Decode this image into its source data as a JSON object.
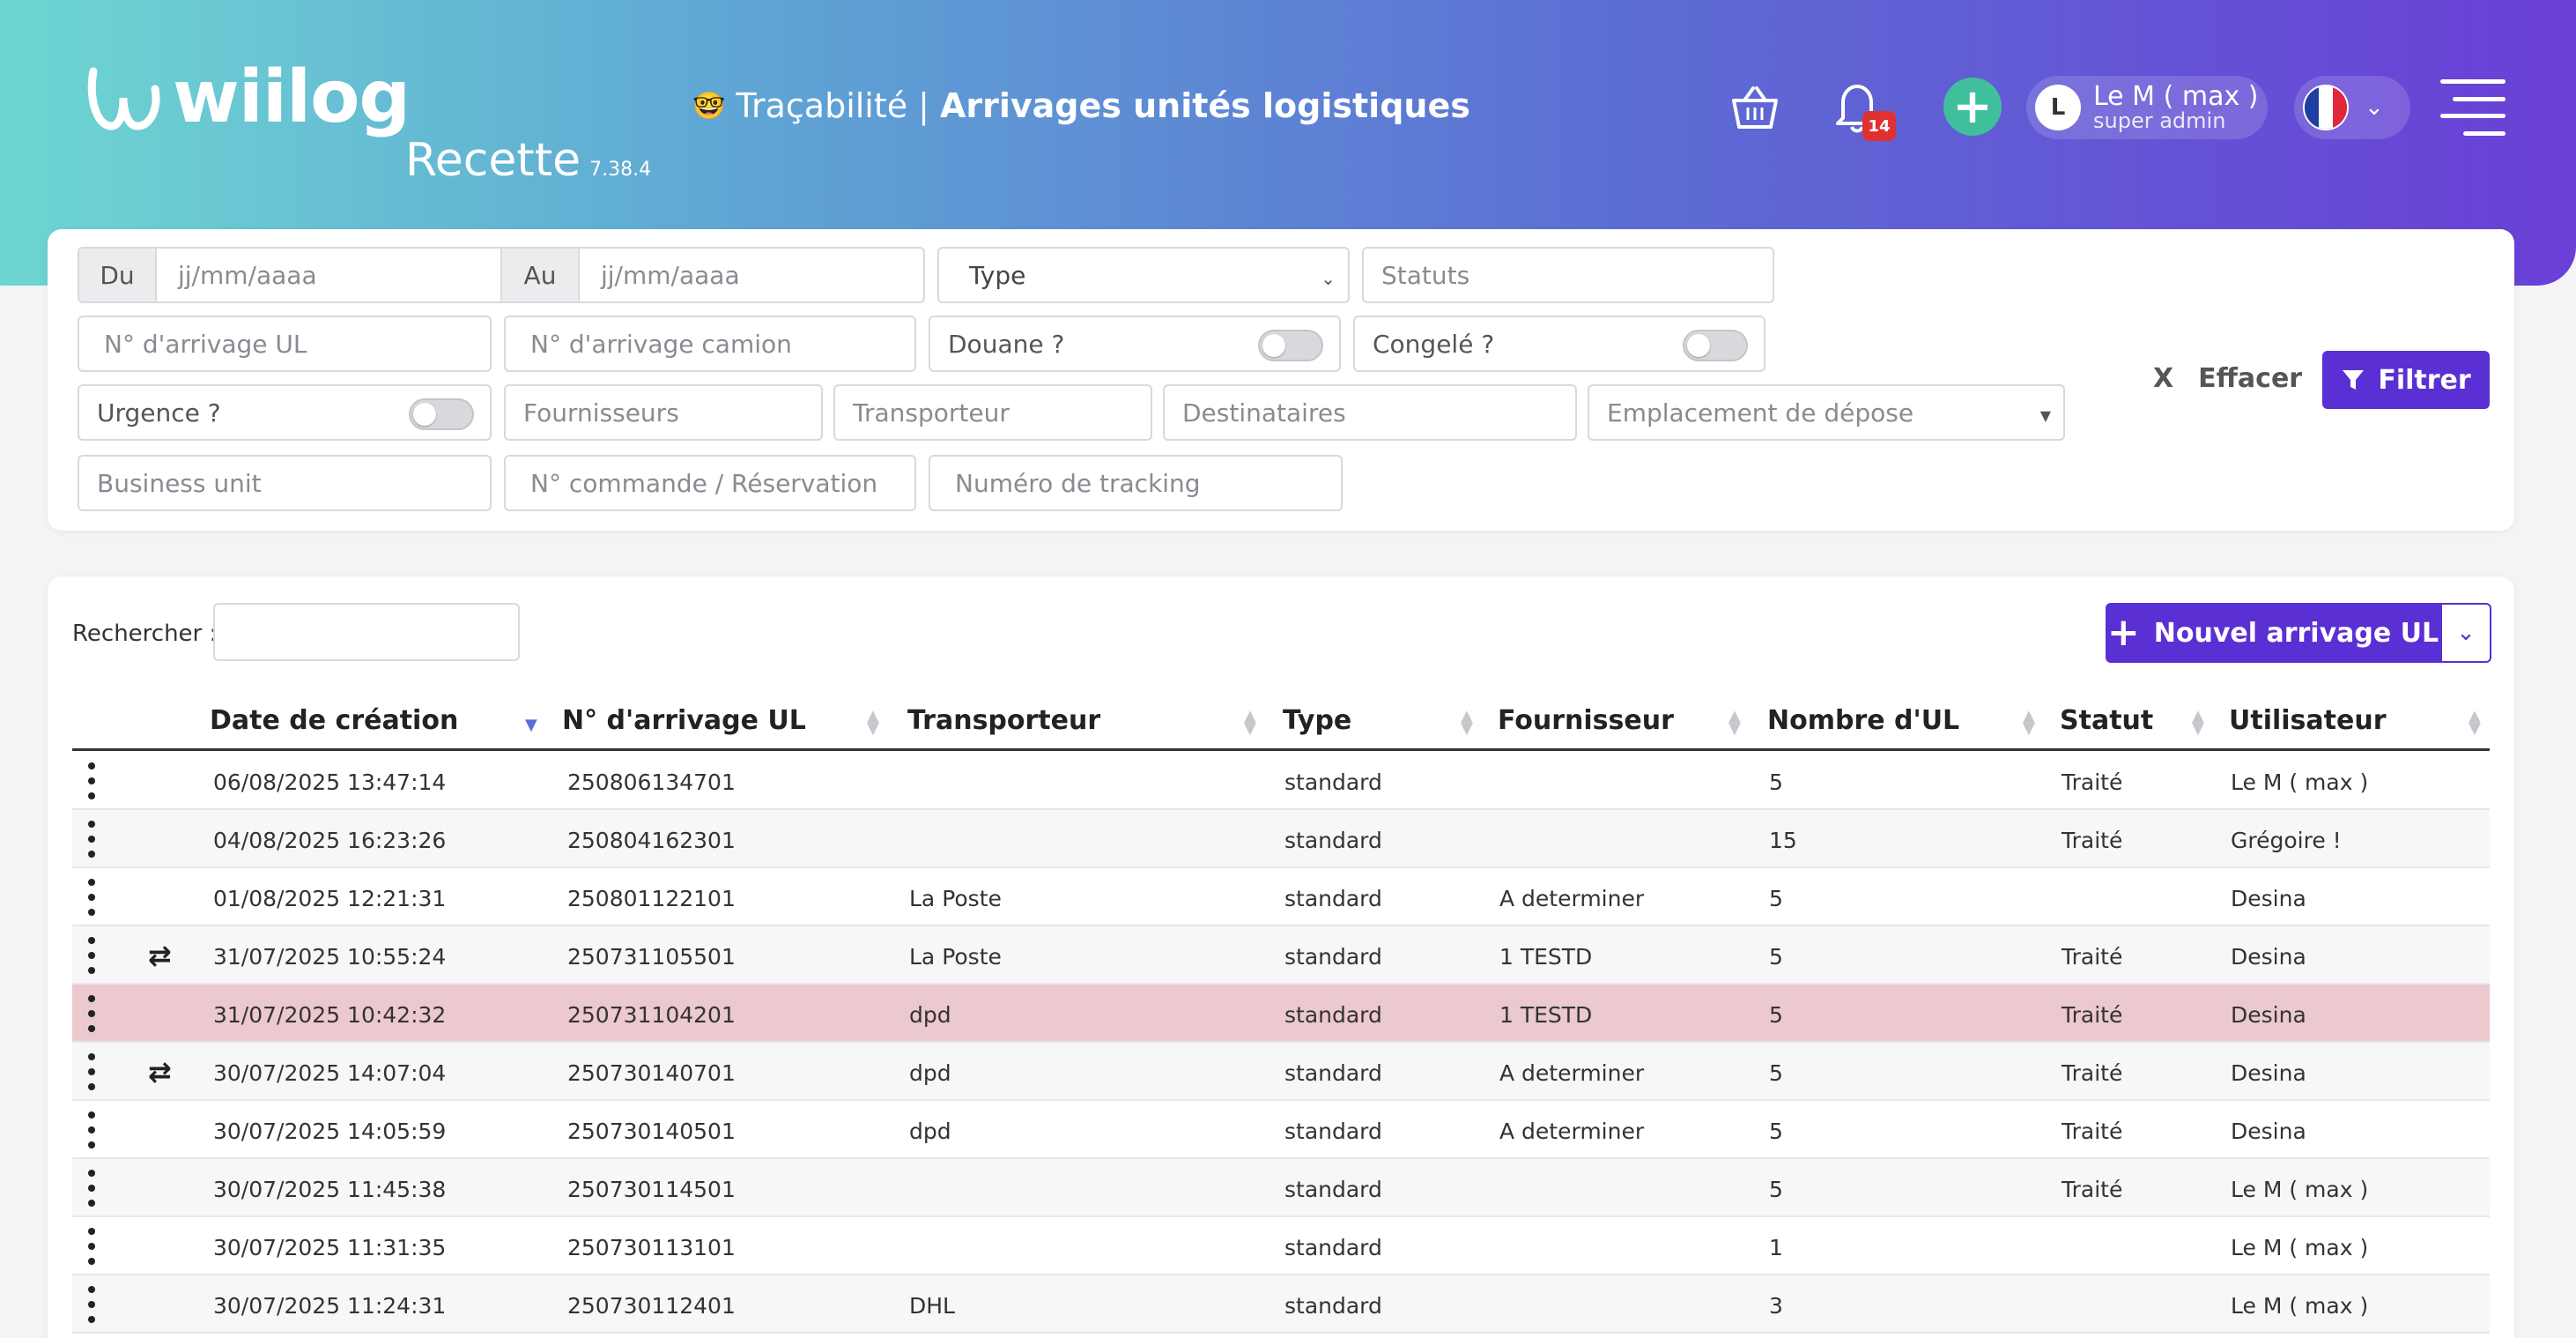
{
  "app": {
    "brand": "wiilog",
    "environment": "Recette",
    "version": "7.38.4",
    "title_emoji": "🤓",
    "title_section": "Traçabilité",
    "title_separator": "|",
    "title_page": "Arrivages unités logistiques"
  },
  "header": {
    "notification_count": "14",
    "user_initial": "L",
    "user_name": "Le M ( max )",
    "user_role": "super admin",
    "icons": [
      "basket-icon",
      "bell-icon",
      "plus-icon",
      "chevron-down-icon",
      "hamburger-menu-icon"
    ]
  },
  "filters": {
    "date_from_label": "Du",
    "date_from_placeholder": "jj/mm/aaaa",
    "date_to_label": "Au",
    "date_to_placeholder": "jj/mm/aaaa",
    "type_select": "Type",
    "statuts": "Statuts",
    "arrival_ul": "N° d'arrivage UL",
    "arrival_truck": "N° d'arrivage camion",
    "customs": "Douane ?",
    "frozen": "Congelé ?",
    "urgency": "Urgence ?",
    "suppliers": "Fournisseurs",
    "carrier": "Transporteur",
    "recipients": "Destinataires",
    "drop_location": "Emplacement de dépose",
    "business_unit": "Business unit",
    "order_number": "N° commande / Réservation",
    "tracking_number": "Numéro de tracking",
    "clear_x": "X",
    "clear_label": "Effacer",
    "filter_label": "Filtrer"
  },
  "table": {
    "search_label": "Rechercher :",
    "new_button": "Nouvel arrivage UL",
    "columns": [
      "Date de création",
      "N° d'arrivage UL",
      "Transporteur",
      "Type",
      "Fournisseur",
      "Nombre d'UL",
      "Statut",
      "Utilisateur"
    ],
    "rows": [
      {
        "date": "06/08/2025 13:47:14",
        "number": "250806134701",
        "carrier": "",
        "type": "standard",
        "supplier": "",
        "count": "5",
        "status": "Traité",
        "user": "Le M ( max )",
        "swap": false,
        "highlight": false
      },
      {
        "date": "04/08/2025 16:23:26",
        "number": "250804162301",
        "carrier": "",
        "type": "standard",
        "supplier": "",
        "count": "15",
        "status": "Traité",
        "user": "Grégoire !",
        "swap": false,
        "highlight": false
      },
      {
        "date": "01/08/2025 12:21:31",
        "number": "250801122101",
        "carrier": "La Poste",
        "type": "standard",
        "supplier": "A determiner",
        "count": "5",
        "status": "",
        "user": "Desina",
        "swap": false,
        "highlight": false
      },
      {
        "date": "31/07/2025 10:55:24",
        "number": "250731105501",
        "carrier": "La Poste",
        "type": "standard",
        "supplier": "1 TESTD",
        "count": "5",
        "status": "Traité",
        "user": "Desina",
        "swap": true,
        "highlight": false
      },
      {
        "date": "31/07/2025 10:42:32",
        "number": "250731104201",
        "carrier": "dpd",
        "type": "standard",
        "supplier": "1 TESTD",
        "count": "5",
        "status": "Traité",
        "user": "Desina",
        "swap": false,
        "highlight": true
      },
      {
        "date": "30/07/2025 14:07:04",
        "number": "250730140701",
        "carrier": "dpd",
        "type": "standard",
        "supplier": "A determiner",
        "count": "5",
        "status": "Traité",
        "user": "Desina",
        "swap": true,
        "highlight": false
      },
      {
        "date": "30/07/2025 14:05:59",
        "number": "250730140501",
        "carrier": "dpd",
        "type": "standard",
        "supplier": "A determiner",
        "count": "5",
        "status": "Traité",
        "user": "Desina",
        "swap": false,
        "highlight": false
      },
      {
        "date": "30/07/2025 11:45:38",
        "number": "250730114501",
        "carrier": "",
        "type": "standard",
        "supplier": "",
        "count": "5",
        "status": "Traité",
        "user": "Le M ( max )",
        "swap": false,
        "highlight": false
      },
      {
        "date": "30/07/2025 11:31:35",
        "number": "250730113101",
        "carrier": "",
        "type": "standard",
        "supplier": "",
        "count": "1",
        "status": "",
        "user": "Le M ( max )",
        "swap": false,
        "highlight": false
      },
      {
        "date": "30/07/2025 11:24:31",
        "number": "250730112401",
        "carrier": "DHL",
        "type": "standard",
        "supplier": "",
        "count": "3",
        "status": "",
        "user": "Le M ( max )",
        "swap": false,
        "highlight": false
      }
    ]
  },
  "colors": {
    "primary": "#5a2fd3",
    "accent_green": "#3fbf9b",
    "badge_red": "#e03131",
    "row_highlight": "#ecc8cf"
  }
}
